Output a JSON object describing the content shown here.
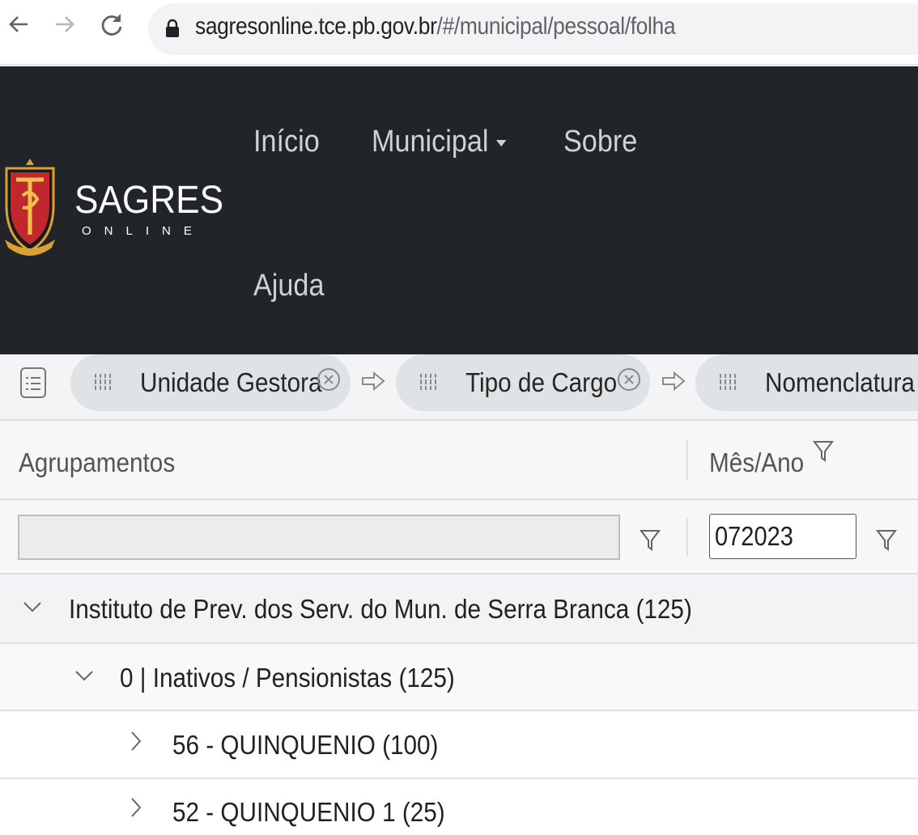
{
  "browser": {
    "url_host": "sagresonline.tce.pb.gov.br",
    "url_path": "/#/municipal/pessoal/folha",
    "icons": [
      "back-arrow-icon",
      "forward-arrow-icon",
      "reload-icon",
      "lock-icon"
    ]
  },
  "header": {
    "brand": "SAGRES",
    "brand_sub": "ONLINE",
    "nav": {
      "inicio": "Início",
      "municipal": "Municipal",
      "sobre": "Sobre",
      "ajuda": "Ajuda"
    },
    "colors": {
      "background": "#212428",
      "nav_text": "#cfd1d4",
      "crest_red": "#c1272d",
      "crest_gold": "#d9a233"
    }
  },
  "group_panel": {
    "chips": [
      {
        "label": "Unidade Gestora"
      },
      {
        "label": "Tipo de Cargo"
      },
      {
        "label": "Nomenclatura"
      }
    ]
  },
  "grid": {
    "columns": {
      "agrupamentos": "Agrupamentos",
      "mes_ano": "Mês/Ano"
    },
    "filters": {
      "agrupamentos_value": "",
      "mes_ano_value": "072023"
    },
    "rows": [
      {
        "label": "Instituto de Prev. dos Serv. do Mun. de Serra Branca (125)",
        "expanded": true
      },
      {
        "label": "0 | Inativos / Pensionistas (125)",
        "expanded": true
      },
      {
        "label": "56 - QUINQUENIO (100)",
        "expanded": false
      },
      {
        "label": "52 - QUINQUENIO 1 (25)",
        "expanded": false
      }
    ]
  }
}
